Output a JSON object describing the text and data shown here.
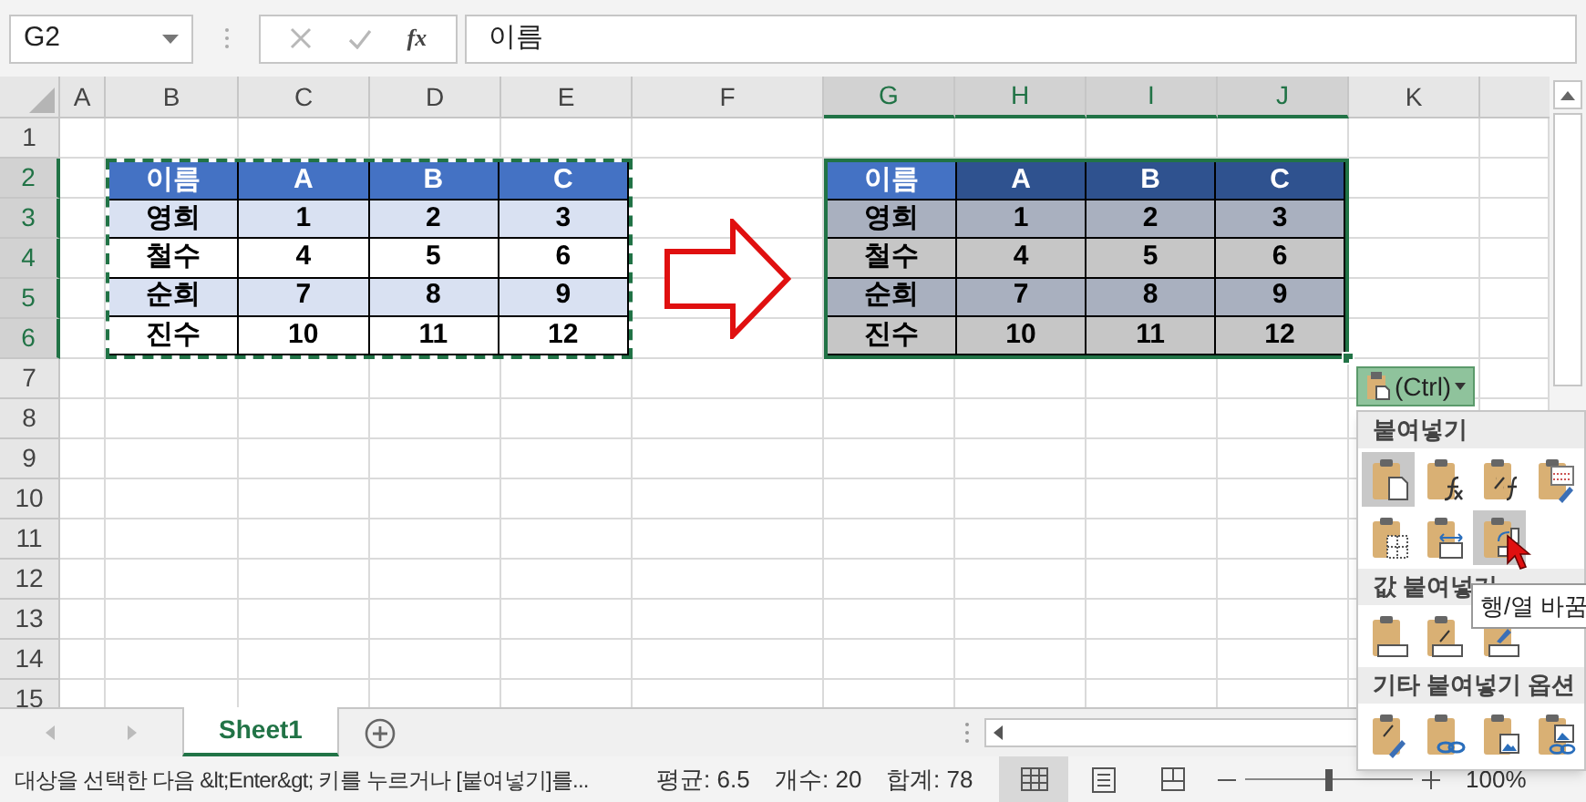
{
  "name_box": "G2",
  "formula_bar": {
    "function_label": "fx",
    "value": "이름"
  },
  "columns": [
    {
      "label": "A",
      "selected": false
    },
    {
      "label": "B",
      "selected": false
    },
    {
      "label": "C",
      "selected": false
    },
    {
      "label": "D",
      "selected": false
    },
    {
      "label": "E",
      "selected": false
    },
    {
      "label": "F",
      "selected": false
    },
    {
      "label": "G",
      "selected": true
    },
    {
      "label": "H",
      "selected": true
    },
    {
      "label": "I",
      "selected": true
    },
    {
      "label": "J",
      "selected": true
    },
    {
      "label": "K",
      "selected": false
    }
  ],
  "rows": [
    {
      "label": "1",
      "selected": false
    },
    {
      "label": "2",
      "selected": true
    },
    {
      "label": "3",
      "selected": true
    },
    {
      "label": "4",
      "selected": true
    },
    {
      "label": "5",
      "selected": true
    },
    {
      "label": "6",
      "selected": true
    },
    {
      "label": "7",
      "selected": false
    },
    {
      "label": "8",
      "selected": false
    },
    {
      "label": "9",
      "selected": false
    },
    {
      "label": "10",
      "selected": false
    },
    {
      "label": "11",
      "selected": false
    },
    {
      "label": "12",
      "selected": false
    },
    {
      "label": "13",
      "selected": false
    },
    {
      "label": "14",
      "selected": false
    },
    {
      "label": "15",
      "selected": false
    }
  ],
  "source_table": {
    "copy_marquee": true,
    "selected": false,
    "header": [
      {
        "text": "이름"
      },
      {
        "text": "A"
      },
      {
        "text": "B"
      },
      {
        "text": "C"
      }
    ],
    "rows": [
      {
        "banded": true,
        "cells": [
          "영희",
          "1",
          "2",
          "3"
        ]
      },
      {
        "banded": false,
        "cells": [
          "철수",
          "4",
          "5",
          "6"
        ]
      },
      {
        "banded": true,
        "cells": [
          "순희",
          "7",
          "8",
          "9"
        ]
      },
      {
        "banded": false,
        "cells": [
          "진수",
          "10",
          "11",
          "12"
        ]
      }
    ]
  },
  "pasted_table": {
    "copy_marquee": false,
    "selected": true,
    "header": [
      {
        "text": "이름",
        "active": true
      },
      {
        "text": "A",
        "active": false
      },
      {
        "text": "B",
        "active": false
      },
      {
        "text": "C",
        "active": false
      }
    ],
    "rows": [
      {
        "banded": true,
        "cells": [
          "영희",
          "1",
          "2",
          "3"
        ]
      },
      {
        "banded": false,
        "cells": [
          "철수",
          "4",
          "5",
          "6"
        ]
      },
      {
        "banded": true,
        "cells": [
          "순희",
          "7",
          "8",
          "9"
        ]
      },
      {
        "banded": false,
        "cells": [
          "진수",
          "10",
          "11",
          "12"
        ]
      }
    ]
  },
  "paste_options": {
    "button": "(Ctrl)",
    "sections": [
      {
        "title": "붙여넣기",
        "items": [
          {
            "kind": "paste",
            "highlighted": true
          },
          {
            "kind": "formulas",
            "highlighted": false
          },
          {
            "kind": "formulas-number",
            "highlighted": false
          },
          {
            "kind": "keep-format",
            "highlighted": false
          },
          {
            "kind": "no-borders",
            "highlighted": false
          },
          {
            "kind": "column-widths",
            "highlighted": false
          },
          {
            "kind": "transpose",
            "highlighted": true
          }
        ]
      },
      {
        "title": "값 붙여넣기",
        "items": [
          {
            "kind": "values",
            "highlighted": false
          },
          {
            "kind": "values-number",
            "highlighted": false
          },
          {
            "kind": "values-format",
            "highlighted": false
          }
        ]
      },
      {
        "title": "기타 붙여넣기 옵션",
        "items": [
          {
            "kind": "formatting",
            "highlighted": false
          },
          {
            "kind": "link",
            "highlighted": false
          },
          {
            "kind": "picture",
            "highlighted": false
          },
          {
            "kind": "linked-picture",
            "highlighted": false
          }
        ]
      }
    ],
    "tooltip": "행/열 바꿈"
  },
  "sheet_tabs": [
    {
      "label": "Sheet1",
      "selected": true
    }
  ],
  "status_bar": {
    "message": "대상을 선택한 다음 &lt;Enter&gt; 키를 누르거나 [붙여넣기]를...",
    "average": "평균: 6.5",
    "count": "개수: 20",
    "sum": "합계: 78",
    "zoom": "100%",
    "zoom_slider": {
      "level": 0.5
    }
  }
}
